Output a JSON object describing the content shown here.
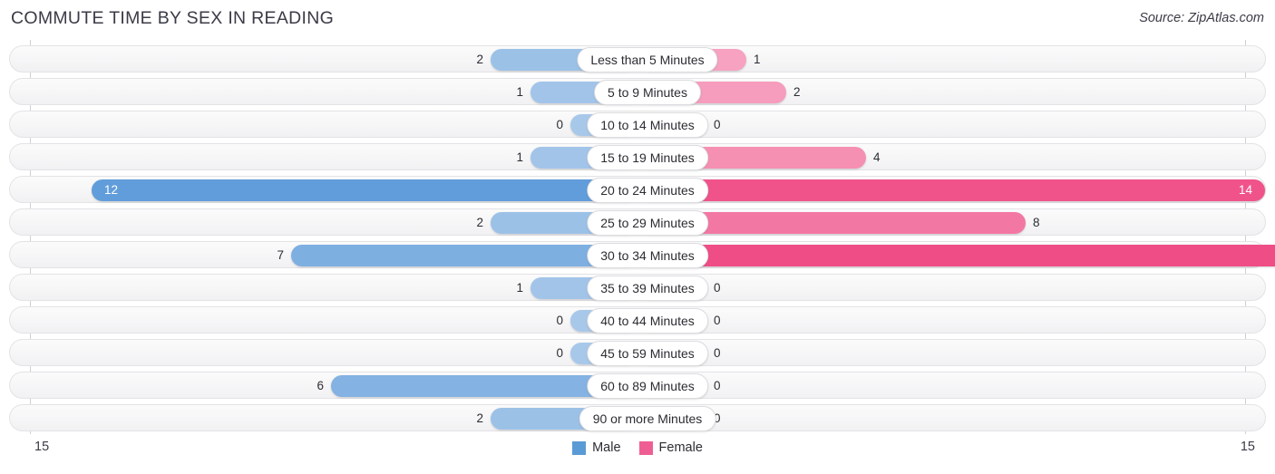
{
  "header": {
    "title": "COMMUTE TIME BY SEX IN READING",
    "source": "Source: ZipAtlas.com"
  },
  "legend": {
    "male_label": "Male",
    "female_label": "Female",
    "male_color": "#5b9bd5",
    "female_color": "#ef5e92"
  },
  "axis": {
    "left_tick": "15",
    "right_tick": "15",
    "max": 15
  },
  "chart_data": {
    "type": "bar",
    "orientation": "horizontal",
    "layout": "diverging-bidirectional",
    "title": "COMMUTE TIME BY SEX IN READING",
    "xlabel": "",
    "ylabel": "",
    "xlim": [
      15,
      15
    ],
    "grid": false,
    "legend_position": "bottom-center",
    "categories": [
      "Less than 5 Minutes",
      "5 to 9 Minutes",
      "10 to 14 Minutes",
      "15 to 19 Minutes",
      "20 to 24 Minutes",
      "25 to 29 Minutes",
      "30 to 34 Minutes",
      "35 to 39 Minutes",
      "40 to 44 Minutes",
      "45 to 59 Minutes",
      "60 to 89 Minutes",
      "90 or more Minutes"
    ],
    "series": [
      {
        "name": "Male",
        "values": [
          2,
          1,
          0,
          1,
          12,
          2,
          7,
          1,
          0,
          0,
          6,
          2
        ]
      },
      {
        "name": "Female",
        "values": [
          1,
          2,
          0,
          4,
          14,
          8,
          15,
          0,
          0,
          0,
          0,
          0
        ]
      }
    ]
  },
  "rows": [
    {
      "label": "Less than 5 Minutes",
      "male": "2",
      "female": "1"
    },
    {
      "label": "5 to 9 Minutes",
      "male": "1",
      "female": "2"
    },
    {
      "label": "10 to 14 Minutes",
      "male": "0",
      "female": "0"
    },
    {
      "label": "15 to 19 Minutes",
      "male": "1",
      "female": "4"
    },
    {
      "label": "20 to 24 Minutes",
      "male": "12",
      "female": "14"
    },
    {
      "label": "25 to 29 Minutes",
      "male": "2",
      "female": "8"
    },
    {
      "label": "30 to 34 Minutes",
      "male": "7",
      "female": "15"
    },
    {
      "label": "35 to 39 Minutes",
      "male": "1",
      "female": "0"
    },
    {
      "label": "40 to 44 Minutes",
      "male": "0",
      "female": "0"
    },
    {
      "label": "45 to 59 Minutes",
      "male": "0",
      "female": "0"
    },
    {
      "label": "60 to 89 Minutes",
      "male": "6",
      "female": "0"
    },
    {
      "label": "90 or more Minutes",
      "male": "2",
      "female": "0"
    }
  ]
}
